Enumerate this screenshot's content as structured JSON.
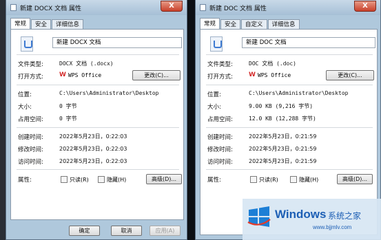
{
  "left": {
    "title": "新建 DOCX 文档 属性",
    "tabs": [
      "常规",
      "安全",
      "详细信息"
    ],
    "filename": "新建 DOCX 文档",
    "rows": {
      "type_label": "文件类型:",
      "type_value": "DOCX 文档 (.docx)",
      "open_label": "打开方式:",
      "open_app": "WPS Office",
      "change_btn": "更改(C)...",
      "location_label": "位置:",
      "location_value": "C:\\Users\\Administrator\\Desktop",
      "size_label": "大小:",
      "size_value": "0 字节",
      "disk_label": "占用空间:",
      "disk_value": "0 字节",
      "created_label": "创建时间:",
      "created_value": "2022年5月23日，0:22:03",
      "modified_label": "修改时间:",
      "modified_value": "2022年5月23日，0:22:03",
      "accessed_label": "访问时间:",
      "accessed_value": "2022年5月23日，0:22:03",
      "attr_label": "属性:",
      "readonly": "只读(R)",
      "hidden": "隐藏(H)",
      "advanced_btn": "高级(D)..."
    },
    "buttons": {
      "ok": "确定",
      "cancel": "取消",
      "apply": "应用(A)"
    }
  },
  "right": {
    "title": "新建 DOC 文档 属性",
    "tabs": [
      "常规",
      "安全",
      "自定义",
      "详细信息"
    ],
    "filename": "新建 DOC 文档",
    "rows": {
      "type_label": "文件类型:",
      "type_value": "DOC 文档 (.doc)",
      "open_label": "打开方式:",
      "open_app": "WPS Office",
      "change_btn": "更改(C)...",
      "location_label": "位置:",
      "location_value": "C:\\Users\\Administrator\\Desktop",
      "size_label": "大小:",
      "size_value": "9.00 KB (9,216 字节)",
      "disk_label": "占用空间:",
      "disk_value": "12.0 KB (12,288 字节)",
      "created_label": "创建时间:",
      "created_value": "2022年5月23日，0:21:59",
      "modified_label": "修改时间:",
      "modified_value": "2022年5月23日，0:21:59",
      "accessed_label": "访问时间:",
      "accessed_value": "2022年5月23日，0:21:59",
      "attr_label": "属性:",
      "readonly": "只读(R)",
      "hidden": "隐藏(H)",
      "advanced_btn": "高级(D)..."
    }
  },
  "close_glyph": "X",
  "wps_glyph": "W",
  "watermark": {
    "brand": "Windows",
    "cn": "系统之家",
    "url": "www.bjjmlv.com"
  }
}
